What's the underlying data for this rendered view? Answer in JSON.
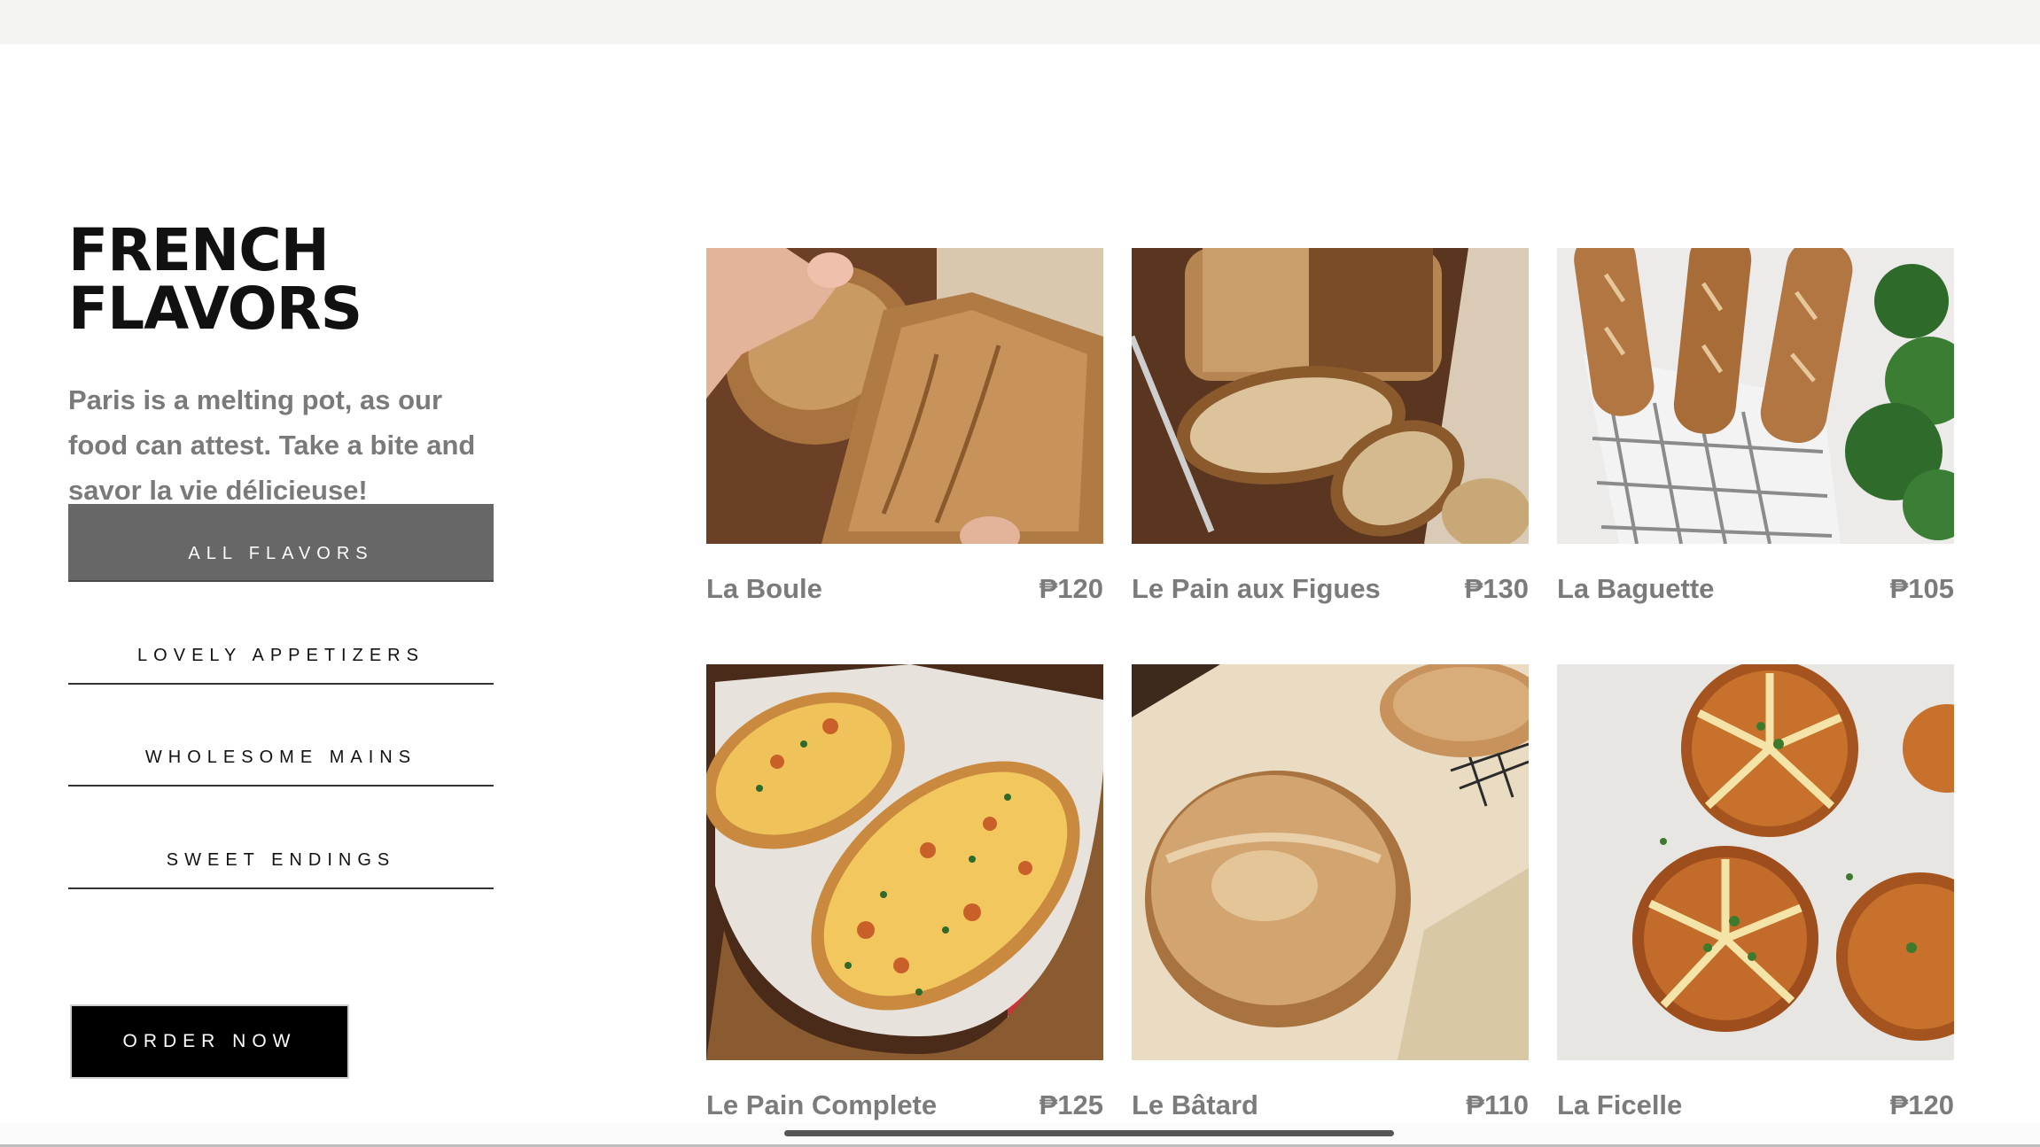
{
  "section": {
    "title": "FRENCH FLAVORS",
    "description": "Paris is a melting pot, as our food can attest. Take a bite and savor la vie délicieuse!"
  },
  "nav": {
    "items": [
      {
        "label": "ALL FLAVORS",
        "active": true
      },
      {
        "label": "LOVELY APPETIZERS",
        "active": false
      },
      {
        "label": "WHOLESOME MAINS",
        "active": false
      },
      {
        "label": "SWEET ENDINGS",
        "active": false
      }
    ]
  },
  "order_button": {
    "label": "ORDER NOW"
  },
  "products": [
    {
      "name": "La Boule",
      "price": "₱120",
      "image": "boule-bread-photo"
    },
    {
      "name": "Le Pain aux Figues",
      "price": "₱130",
      "image": "fig-bread-photo"
    },
    {
      "name": "La Baguette",
      "price": "₱105",
      "image": "baguette-photo"
    },
    {
      "name": "Le Pain Complete",
      "price": "₱125",
      "image": "cheese-bread-photo"
    },
    {
      "name": "Le Bâtard",
      "price": "₱110",
      "image": "batard-photo"
    },
    {
      "name": "La Ficelle",
      "price": "₱120",
      "image": "garlic-bun-photo"
    }
  ],
  "colors": {
    "accent_active": "#676767",
    "button_black": "#000000",
    "text_muted": "#7b7b7b"
  }
}
